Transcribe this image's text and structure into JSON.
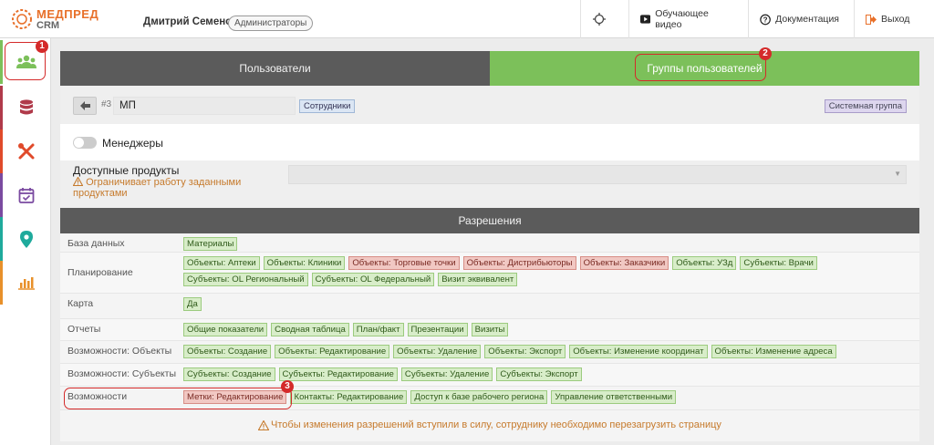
{
  "app": {
    "logo_line1": "МЕДПРЕД",
    "logo_line2": "CRM"
  },
  "header": {
    "user_name": "Дмитрий Семенов",
    "role": "Администраторы",
    "nav": {
      "video": "Обучающее видео",
      "docs": "Документация",
      "logout": "Выход"
    }
  },
  "tabs": {
    "users": "Пользователи",
    "groups": "Группы пользователей"
  },
  "group": {
    "id": "#3",
    "name": "МП",
    "employees_tag": "Сотрудники",
    "system_tag": "Системная группа"
  },
  "managers_toggle": {
    "label": "Менеджеры",
    "on": false
  },
  "products": {
    "title": "Доступные продукты",
    "warning": "Ограничивает работу заданными продуктами"
  },
  "permissions": {
    "title": "Разрешения",
    "rows": [
      {
        "label": "База данных",
        "tags": [
          {
            "text": "Материалы",
            "state": "green"
          }
        ]
      },
      {
        "label": "Планирование",
        "tags": [
          {
            "text": "Объекты: Аптеки",
            "state": "green"
          },
          {
            "text": "Объекты: Клиники",
            "state": "green"
          },
          {
            "text": "Объекты: Торговые точки",
            "state": "red"
          },
          {
            "text": "Объекты: Дистрибьюторы",
            "state": "red"
          },
          {
            "text": "Объекты: Заказчики",
            "state": "red"
          },
          {
            "text": "Объекты: УЗд",
            "state": "green"
          },
          {
            "text": "Субъекты: Врачи",
            "state": "green"
          },
          {
            "text": "Субъекты: OL Региональный",
            "state": "green"
          },
          {
            "text": "Субъекты: OL Федеральный",
            "state": "green"
          },
          {
            "text": "Визит эквивалент",
            "state": "green"
          }
        ]
      },
      {
        "label": "Карта",
        "tags": [
          {
            "text": "Да",
            "state": "green"
          }
        ]
      },
      {
        "label": "Отчеты",
        "tags": [
          {
            "text": "Общие показатели",
            "state": "green"
          },
          {
            "text": "Сводная таблица",
            "state": "green"
          },
          {
            "text": "План/факт",
            "state": "green"
          },
          {
            "text": "Презентации",
            "state": "green"
          },
          {
            "text": "Визиты",
            "state": "green"
          }
        ]
      },
      {
        "label": "Возможности: Объекты",
        "tags": [
          {
            "text": "Объекты: Создание",
            "state": "green"
          },
          {
            "text": "Объекты: Редактирование",
            "state": "green"
          },
          {
            "text": "Объекты: Удаление",
            "state": "green"
          },
          {
            "text": "Объекты: Экспорт",
            "state": "green"
          },
          {
            "text": "Объекты: Изменение координат",
            "state": "green"
          },
          {
            "text": "Объекты: Изменение адреса",
            "state": "green"
          }
        ]
      },
      {
        "label": "Возможности: Субъекты",
        "tags": [
          {
            "text": "Субъекты: Создание",
            "state": "green"
          },
          {
            "text": "Субъекты: Редактирование",
            "state": "green"
          },
          {
            "text": "Субъекты: Удаление",
            "state": "green"
          },
          {
            "text": "Субъекты: Экспорт",
            "state": "green"
          }
        ]
      },
      {
        "label": "Возможности",
        "tags": [
          {
            "text": "Метки: Редактирование",
            "state": "red"
          },
          {
            "text": "Контакты: Редактирование",
            "state": "green"
          },
          {
            "text": "Доступ к базе рабочего региона",
            "state": "green"
          },
          {
            "text": "Управление ответственными",
            "state": "green"
          }
        ]
      }
    ],
    "footer_warning": "Чтобы изменения разрешений вступили в силу, сотруднику необходимо перезагрузить страницу"
  },
  "callouts": [
    "1",
    "2",
    "3"
  ],
  "colors": {
    "accent_green": "#7cc05a",
    "dark_tab": "#5b5b5b",
    "callout_red": "#d42a2a",
    "warning_orange": "#c67a2c"
  },
  "sidebar_icons": [
    "users-icon",
    "database-icon",
    "tools-icon",
    "calendar-icon",
    "map-pin-icon",
    "bar-chart-icon"
  ]
}
